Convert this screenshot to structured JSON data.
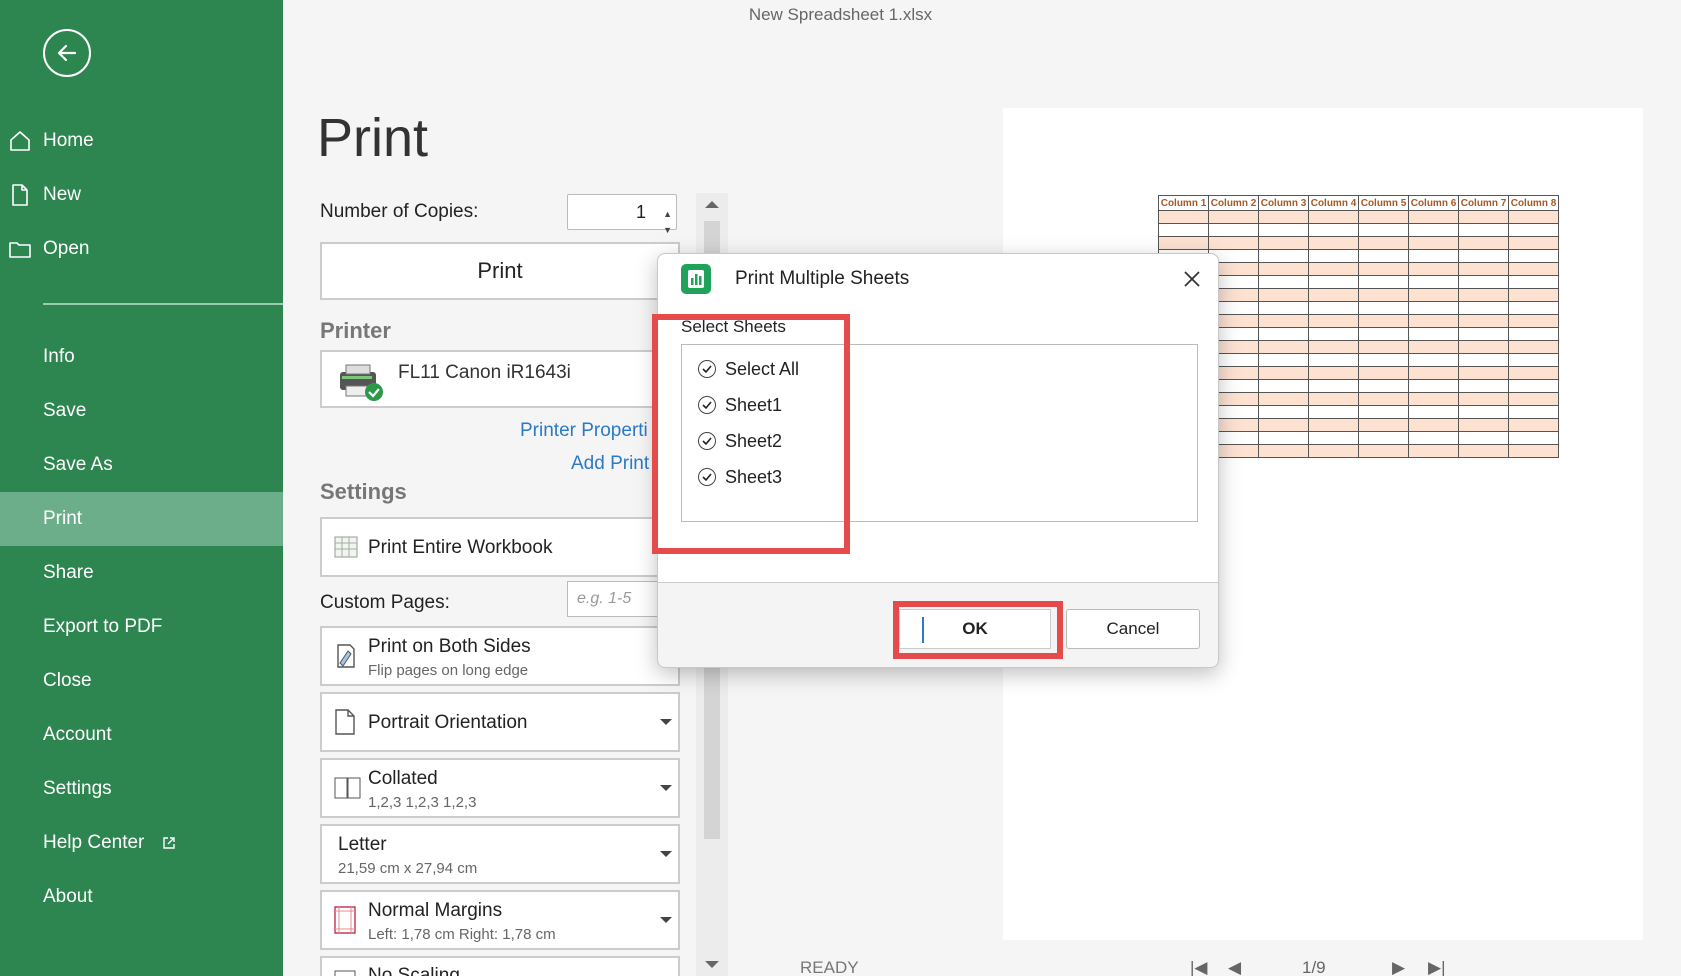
{
  "window": {
    "title": "New Spreadsheet 1.xlsx"
  },
  "sidebar": {
    "items": [
      {
        "label": "Home"
      },
      {
        "label": "New"
      },
      {
        "label": "Open"
      },
      {
        "label": "Info"
      },
      {
        "label": "Save"
      },
      {
        "label": "Save As"
      },
      {
        "label": "Print"
      },
      {
        "label": "Share"
      },
      {
        "label": "Export to PDF"
      },
      {
        "label": "Close"
      },
      {
        "label": "Account"
      },
      {
        "label": "Settings"
      },
      {
        "label": "Help Center"
      },
      {
        "label": "About"
      }
    ],
    "active": "Print"
  },
  "print_panel": {
    "heading": "Print",
    "copies_label": "Number of Copies:",
    "copies_value": "1",
    "print_button": "Print",
    "printer_heading": "Printer",
    "printer_name": "FL11 Canon iR1643i",
    "printer_properties_link": "Printer Properti",
    "add_printer_link": "Add Print",
    "settings_heading": "Settings",
    "scope": "Print Entire Workbook",
    "custom_pages_label": "Custom Pages:",
    "custom_pages_placeholder": "e.g. 1-5",
    "sides_main": "Print on Both Sides",
    "sides_sub": "Flip pages on long edge",
    "orientation": "Portrait Orientation",
    "collation_main": "Collated",
    "collation_sub": "1,2,3 1,2,3 1,2,3",
    "paper_main": "Letter",
    "paper_sub": "21,59 cm x 27,94 cm",
    "margins_main": "Normal Margins",
    "margins_sub": "Left: 1,78 cm Right: 1,78 cm",
    "scaling": "No Scaling"
  },
  "preview": {
    "columns": [
      "Column 1",
      "Column 2",
      "Column 3",
      "Column 4",
      "Column 5",
      "Column 6",
      "Column 7",
      "Column 8"
    ],
    "row_count": 19,
    "status": "READY",
    "page_indicator": "1/9"
  },
  "dialog": {
    "title": "Print Multiple Sheets",
    "section_label": "Select Sheets",
    "options": [
      {
        "label": "Select All",
        "checked": true
      },
      {
        "label": "Sheet1",
        "checked": true
      },
      {
        "label": "Sheet2",
        "checked": true
      },
      {
        "label": "Sheet3",
        "checked": true
      }
    ],
    "ok_label": "OK",
    "cancel_label": "Cancel"
  },
  "colors": {
    "sidebar": "#2d8550",
    "sidebar_active": "#6bae89",
    "highlight": "#e54b4b",
    "link": "#2b7ac7"
  }
}
